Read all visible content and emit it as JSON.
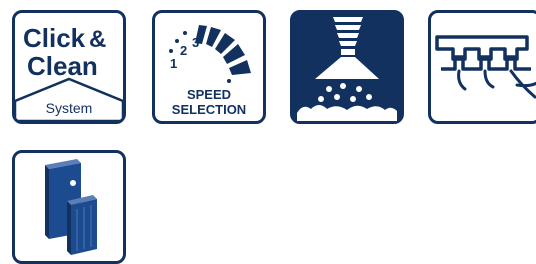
{
  "icons": [
    {
      "icon": "click-clean-system-icon",
      "line1": "Click",
      "amp": "&",
      "line2": "Clean",
      "sub": "System"
    },
    {
      "icon": "speed-selection-icon",
      "ticks": [
        "1",
        "2",
        "3"
      ],
      "line1": "SPEED",
      "line2": "SELECTION"
    },
    {
      "icon": "dust-extraction-icon"
    },
    {
      "icon": "tongue-groove-joint-icon"
    },
    {
      "icon": "workpiece-panels-icon"
    }
  ],
  "colors": {
    "brand": "#12315f",
    "background": "#ffffff"
  }
}
